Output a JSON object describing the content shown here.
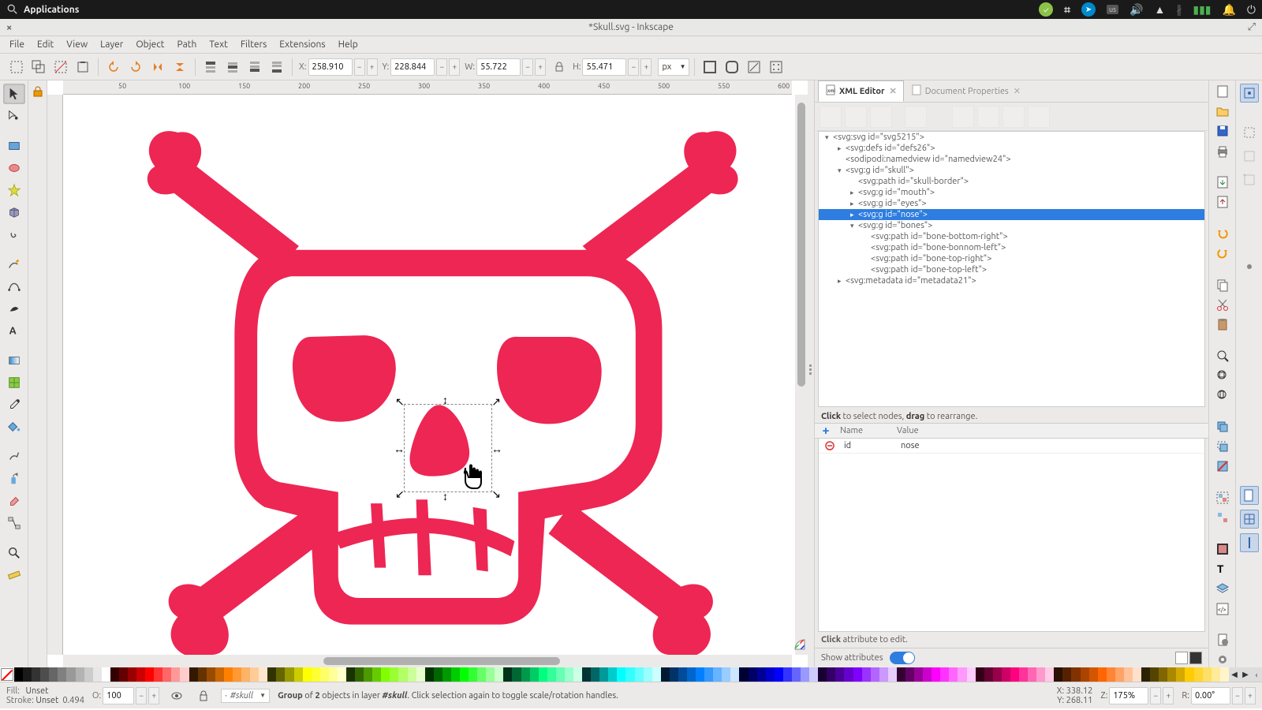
{
  "sysbar": {
    "applications": "Applications",
    "lang": "us"
  },
  "window": {
    "title": "*Skull.svg - Inkscape"
  },
  "menu": [
    "File",
    "Edit",
    "View",
    "Layer",
    "Object",
    "Path",
    "Text",
    "Filters",
    "Extensions",
    "Help"
  ],
  "coords": {
    "x_label": "X:",
    "x": "258.910",
    "y_label": "Y:",
    "y": "228.844",
    "w_label": "W:",
    "w": "55.722",
    "h_label": "H:",
    "h": "55.471",
    "unit": "px"
  },
  "ruler_ticks": [
    "50",
    "100",
    "150",
    "200",
    "250",
    "300",
    "350",
    "400",
    "450",
    "500",
    "550",
    "600"
  ],
  "dock": {
    "tab_xml": "XML Editor",
    "tab_docprops": "Document Properties",
    "tree": [
      {
        "indent": 0,
        "tri": "▾",
        "text": "<svg:svg id=\"svg5215\">",
        "sel": false
      },
      {
        "indent": 1,
        "tri": "▸",
        "text": "<svg:defs id=\"defs26\">",
        "sel": false
      },
      {
        "indent": 1,
        "tri": "",
        "text": "<sodipodi:namedview id=\"namedview24\">",
        "sel": false
      },
      {
        "indent": 1,
        "tri": "▾",
        "text": "<svg:g id=\"skull\">",
        "sel": false
      },
      {
        "indent": 2,
        "tri": "",
        "text": "<svg:path id=\"skull-border\">",
        "sel": false
      },
      {
        "indent": 2,
        "tri": "▸",
        "text": "<svg:g id=\"mouth\">",
        "sel": false
      },
      {
        "indent": 2,
        "tri": "▸",
        "text": "<svg:g id=\"eyes\">",
        "sel": false
      },
      {
        "indent": 2,
        "tri": "▸",
        "text": "<svg:g id=\"nose\">",
        "sel": true
      },
      {
        "indent": 2,
        "tri": "▾",
        "text": "<svg:g id=\"bones\">",
        "sel": false
      },
      {
        "indent": 3,
        "tri": "",
        "text": "<svg:path id=\"bone-bottom-right\">",
        "sel": false
      },
      {
        "indent": 3,
        "tri": "",
        "text": "<svg:path id=\"bone-bonnom-left\">",
        "sel": false
      },
      {
        "indent": 3,
        "tri": "",
        "text": "<svg:path id=\"bone-top-right\">",
        "sel": false
      },
      {
        "indent": 3,
        "tri": "",
        "text": "<svg:path id=\"bone-top-left\">",
        "sel": false
      },
      {
        "indent": 1,
        "tri": "▸",
        "text": "<svg:metadata id=\"metadata21\">",
        "sel": false
      }
    ],
    "hint_click": "Click",
    "hint_rest": " to select nodes, ",
    "hint_drag": "drag",
    "hint_rest2": " to rearrange.",
    "attr_name_h": "Name",
    "attr_value_h": "Value",
    "attr_name": "id",
    "attr_value": "nose",
    "hint2_click": "Click",
    "hint2_rest": " attribute to edit.",
    "show_attrs": "Show attributes"
  },
  "status": {
    "fill_l": "Fill:",
    "fill_v": "Unset",
    "stroke_l": "Stroke:",
    "stroke_v": "Unset",
    "stroke_w": "0.494",
    "o_l": "O:",
    "o_v": "100",
    "layer": "#skull",
    "msg_pre": "Group",
    "msg_of": " of ",
    "msg_n": "2",
    "msg_mid": " objects in layer ",
    "msg_layer": "#skull",
    "msg_post": ". Click selection again to toggle scale/rotation handles.",
    "pos_x_l": "X:",
    "pos_x": "338.12",
    "pos_y_l": "Y:",
    "pos_y": "268.11",
    "z_l": "Z:",
    "z_v": "175%",
    "r_l": "R:",
    "r_v": "0.00°",
    "layer_prefix": "·"
  },
  "palette_colors": [
    "#000000",
    "#1a1a1a",
    "#333333",
    "#4d4d4d",
    "#666666",
    "#808080",
    "#999999",
    "#b3b3b3",
    "#cccccc",
    "#e6e6e6",
    "#ffffff",
    "#330000",
    "#660000",
    "#990000",
    "#cc0000",
    "#ff0000",
    "#ff3333",
    "#ff6666",
    "#ff9999",
    "#ffcccc",
    "#331900",
    "#663300",
    "#994c00",
    "#cc6600",
    "#ff8000",
    "#ff9933",
    "#ffb366",
    "#ffcc99",
    "#ffe6cc",
    "#333300",
    "#666600",
    "#999900",
    "#cccc00",
    "#ffff00",
    "#ffff33",
    "#ffff66",
    "#ffff99",
    "#ffffcc",
    "#193300",
    "#336600",
    "#4c9900",
    "#66cc00",
    "#80ff00",
    "#99ff33",
    "#b3ff66",
    "#ccff99",
    "#e6ffcc",
    "#003300",
    "#006600",
    "#009900",
    "#00cc00",
    "#00ff00",
    "#33ff33",
    "#66ff66",
    "#99ff99",
    "#ccffcc",
    "#003319",
    "#006633",
    "#00994c",
    "#00cc66",
    "#00ff80",
    "#33ff99",
    "#66ffb3",
    "#99ffcc",
    "#ccffe6",
    "#003333",
    "#006666",
    "#009999",
    "#00cccc",
    "#00ffff",
    "#33ffff",
    "#66ffff",
    "#99ffff",
    "#ccffff",
    "#001933",
    "#003366",
    "#004c99",
    "#0066cc",
    "#0080ff",
    "#3399ff",
    "#66b3ff",
    "#99ccff",
    "#cce6ff",
    "#000033",
    "#000066",
    "#000099",
    "#0000cc",
    "#0000ff",
    "#3333ff",
    "#6666ff",
    "#9999ff",
    "#ccccff",
    "#190033",
    "#330066",
    "#4c0099",
    "#6600cc",
    "#8000ff",
    "#9933ff",
    "#b366ff",
    "#cc99ff",
    "#e6ccff",
    "#330033",
    "#660066",
    "#990099",
    "#cc00cc",
    "#ff00ff",
    "#ff33ff",
    "#ff66ff",
    "#ff99ff",
    "#ffccff",
    "#330019",
    "#660033",
    "#99004c",
    "#cc0066",
    "#ff0080",
    "#ff3399",
    "#ff66b3",
    "#ff99cc",
    "#ffcce6",
    "#2b1100",
    "#552200",
    "#803300",
    "#aa4400",
    "#d45500",
    "#ff6600",
    "#ff8533",
    "#ffa366",
    "#ffc299",
    "#ffe0cc",
    "#2b2200",
    "#554400",
    "#806600",
    "#aa8800",
    "#d4aa00",
    "#ffcc00",
    "#ffd633",
    "#ffe066",
    "#ffeb99",
    "#fff5cc"
  ]
}
